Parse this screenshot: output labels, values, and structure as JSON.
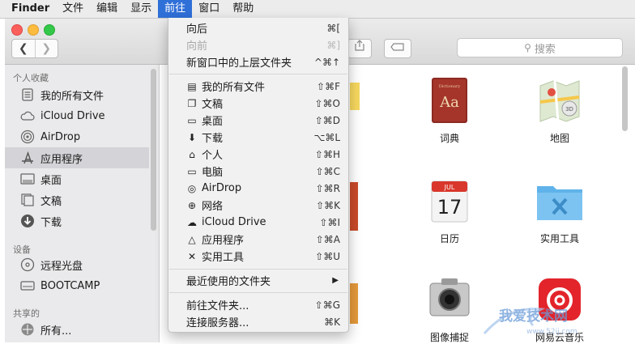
{
  "menubar": {
    "app": "Finder",
    "items": [
      "文件",
      "编辑",
      "显示",
      "前往",
      "窗口",
      "帮助"
    ]
  },
  "search": {
    "placeholder": "搜索"
  },
  "sidebar": {
    "sections": {
      "favorites": "个人收藏",
      "devices": "设备",
      "shared": "共享的"
    },
    "favorites": [
      {
        "label": "我的所有文件",
        "icon": "all-files-icon"
      },
      {
        "label": "iCloud Drive",
        "icon": "cloud-icon"
      },
      {
        "label": "AirDrop",
        "icon": "airdrop-icon"
      },
      {
        "label": "应用程序",
        "icon": "applications-icon"
      },
      {
        "label": "桌面",
        "icon": "desktop-icon"
      },
      {
        "label": "文稿",
        "icon": "documents-icon"
      },
      {
        "label": "下载",
        "icon": "download-icon"
      }
    ],
    "devices": [
      {
        "label": "远程光盘",
        "icon": "remote-disc-icon"
      },
      {
        "label": "BOOTCAMP",
        "icon": "drive-icon"
      }
    ],
    "shared": [
      {
        "label": "所有...",
        "icon": "network-icon"
      }
    ]
  },
  "content": {
    "apps": [
      {
        "label": "词典",
        "icon": "dictionary-icon",
        "badge": "Aa",
        "badge_top": "Dictionary"
      },
      {
        "label": "地图",
        "icon": "maps-icon"
      },
      {
        "label": "日历",
        "icon": "calendar-icon",
        "month": "JUL",
        "day": "17"
      },
      {
        "label": "实用工具",
        "icon": "utilities-folder-icon"
      },
      {
        "label": "图像捕捉",
        "icon": "image-capture-icon"
      },
      {
        "label": "网易云音乐",
        "icon": "netease-music-icon"
      }
    ]
  },
  "go_menu": {
    "items": [
      {
        "label": "向后",
        "shortcut": "⌘[",
        "icon": ""
      },
      {
        "label": "向前",
        "shortcut": "⌘]",
        "icon": ""
      },
      {
        "label": "新窗口中的上层文件夹",
        "shortcut": "^⌘↑",
        "icon": ""
      },
      {
        "label": "我的所有文件",
        "shortcut": "⇧⌘F",
        "icon": "all-files-icon"
      },
      {
        "label": "文稿",
        "shortcut": "⇧⌘O",
        "icon": "documents-icon"
      },
      {
        "label": "桌面",
        "shortcut": "⇧⌘D",
        "icon": "desktop-icon"
      },
      {
        "label": "下载",
        "shortcut": "⌥⌘L",
        "icon": "download-icon"
      },
      {
        "label": "个人",
        "shortcut": "⇧⌘H",
        "icon": "home-icon"
      },
      {
        "label": "电脑",
        "shortcut": "⇧⌘C",
        "icon": "computer-icon"
      },
      {
        "label": "AirDrop",
        "shortcut": "⇧⌘R",
        "icon": "airdrop-icon"
      },
      {
        "label": "网络",
        "shortcut": "⇧⌘K",
        "icon": "network-icon"
      },
      {
        "label": "iCloud Drive",
        "shortcut": "⇧⌘I",
        "icon": "cloud-icon"
      },
      {
        "label": "应用程序",
        "shortcut": "⇧⌘A",
        "icon": "applications-icon"
      },
      {
        "label": "实用工具",
        "shortcut": "⇧⌘U",
        "icon": "utilities-icon"
      },
      {
        "label": "最近使用的文件夹",
        "shortcut": "",
        "icon": "submenu-arrow-icon"
      },
      {
        "label": "前往文件夹...",
        "shortcut": "⇧⌘G",
        "icon": ""
      },
      {
        "label": "连接服务器...",
        "shortcut": "⌘K",
        "icon": ""
      }
    ]
  },
  "watermark": {
    "text": "我爱技术网",
    "url": "www.52ij.com"
  },
  "colors": {
    "menu_highlight": "#2f6fd8",
    "sidebar_bg": "#eaeaec"
  }
}
